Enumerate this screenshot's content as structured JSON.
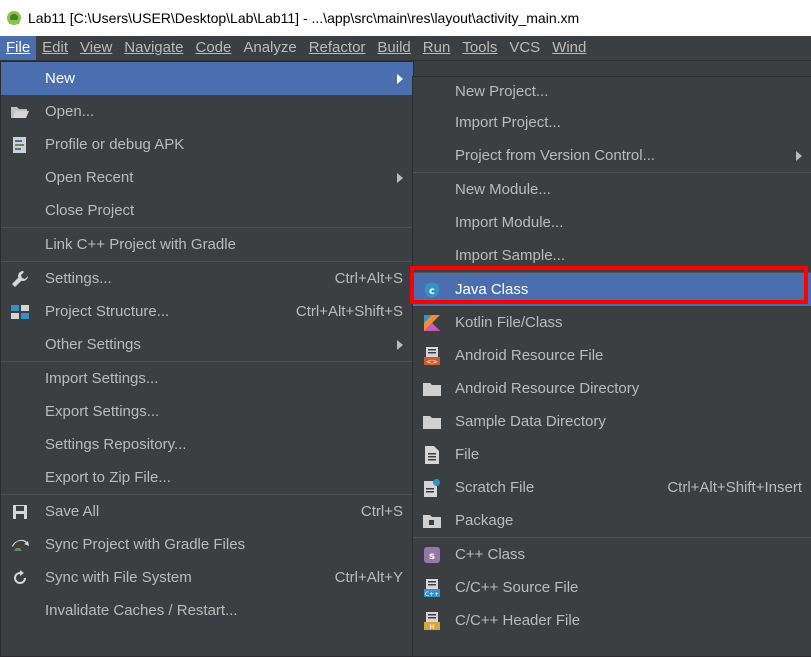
{
  "window": {
    "title": "Lab11 [C:\\Users\\USER\\Desktop\\Lab\\Lab11] - ...\\app\\src\\main\\res\\layout\\activity_main.xm"
  },
  "menubar": [
    {
      "label": "File",
      "active": true
    },
    {
      "label": "Edit"
    },
    {
      "label": "View"
    },
    {
      "label": "Navigate"
    },
    {
      "label": "Code"
    },
    {
      "label": "Analyze"
    },
    {
      "label": "Refactor"
    },
    {
      "label": "Build"
    },
    {
      "label": "Run"
    },
    {
      "label": "Tools"
    },
    {
      "label": "VCS"
    },
    {
      "label": "Wind"
    }
  ],
  "file_menu": {
    "new": "New",
    "open": "Open...",
    "profile": "Profile or debug APK",
    "open_recent": "Open Recent",
    "close_project": "Close Project",
    "link_cpp": "Link C++ Project with Gradle",
    "settings": "Settings...",
    "settings_sc": "Ctrl+Alt+S",
    "project_structure": "Project Structure...",
    "project_structure_sc": "Ctrl+Alt+Shift+S",
    "other_settings": "Other Settings",
    "import_settings": "Import Settings...",
    "export_settings": "Export Settings...",
    "settings_repo": "Settings Repository...",
    "export_zip": "Export to Zip File...",
    "save_all": "Save All",
    "save_all_sc": "Ctrl+S",
    "sync_gradle": "Sync Project with Gradle Files",
    "sync_fs": "Sync with File System",
    "sync_fs_sc": "Ctrl+Alt+Y",
    "invalidate": "Invalidate Caches / Restart..."
  },
  "new_menu": {
    "new_project": "New Project...",
    "import_project": "Import Project...",
    "project_vcs": "Project from Version Control...",
    "new_module": "New Module...",
    "import_module": "Import Module...",
    "import_sample": "Import Sample...",
    "java_class": "Java Class",
    "kotlin": "Kotlin File/Class",
    "android_res_file": "Android Resource File",
    "android_res_dir": "Android Resource Directory",
    "sample_data": "Sample Data Directory",
    "file": "File",
    "scratch": "Scratch File",
    "scratch_sc": "Ctrl+Alt+Shift+Insert",
    "package": "Package",
    "cpp_class": "C++ Class",
    "cpp_source": "C/C++ Source File",
    "cpp_header": "C/C++ Header File"
  },
  "colors": {
    "background": "#3c3f41",
    "selection": "#4b6eaf",
    "highlight": "#ff0000",
    "text": "#bbbbbb"
  }
}
